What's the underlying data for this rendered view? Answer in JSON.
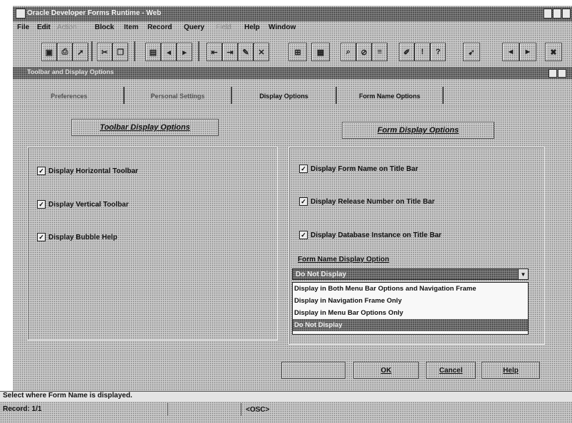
{
  "window": {
    "title": "Oracle Developer Forms Runtime - Web"
  },
  "menu": [
    "File",
    "Edit",
    "Action",
    "Block",
    "Item",
    "Record",
    "Query",
    "Field",
    "Help",
    "Window"
  ],
  "toolbar": {
    "buttons": [
      "save",
      "print",
      "exit",
      "cut",
      "copy",
      "paste",
      "prev-block",
      "prev-record",
      "next-record",
      "next-block",
      "insert",
      "remove",
      "lock",
      "enter-query",
      "execute-query",
      "cancel-query",
      "list",
      "edit",
      "display-error",
      "help",
      "about",
      "close"
    ]
  },
  "form": {
    "title": "Toolbar and Display Options"
  },
  "tabs": [
    "Preferences",
    "Personal Settings",
    "Display Options",
    "Form Name Options",
    ""
  ],
  "toolbar_options": {
    "heading": "Toolbar Display Options",
    "items": [
      {
        "label": "Display Horizontal Toolbar",
        "checked": true
      },
      {
        "label": "Display Vertical Toolbar",
        "checked": true
      },
      {
        "label": "Display Bubble Help",
        "checked": true
      }
    ]
  },
  "form_options": {
    "heading": "Form Display Options",
    "items": [
      {
        "label": "Display Form Name on Title Bar",
        "checked": true
      },
      {
        "label": "Display Release Number on Title Bar",
        "checked": true
      },
      {
        "label": "Display Database Instance on Title Bar",
        "checked": true
      }
    ],
    "dropdown_label": "Form Name Display Option",
    "dropdown_value": "Do Not Display",
    "dropdown_options": [
      "Display in Both Menu Bar Options and Navigation Frame",
      "Display in Navigation Frame Only",
      "Display in Menu Bar Options Only",
      "Do Not Display"
    ]
  },
  "buttons": {
    "b1": "",
    "ok": "OK",
    "cancel": "Cancel",
    "help": "Help"
  },
  "status": {
    "hint": "Select where Form Name is displayed.",
    "record": "Record: 1/1",
    "osc": "<OSC>"
  },
  "colors": {
    "check": "#000000"
  }
}
